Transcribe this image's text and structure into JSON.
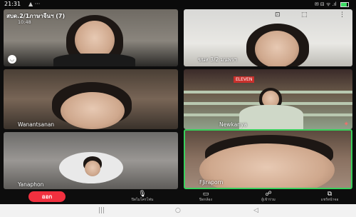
{
  "status_bar": {
    "time": "21:31",
    "extra": "▲ ···",
    "icons": "✉ ⊟ ᯤ .ıl",
    "battery_level": 0.8
  },
  "call": {
    "title": "สบด.2/1ภาษาจีนฯ (7)",
    "subtitle": "10:48"
  },
  "participants": [
    {
      "name": ""
    },
    {
      "name": "ขนส 3/2 มนพรฯ"
    },
    {
      "name": "Wanantsanan"
    },
    {
      "name": "Newkanya"
    },
    {
      "name": "Yanaphon"
    },
    {
      "name": "FJiraporn"
    }
  ],
  "store_sign": "ELEVEN",
  "controls": {
    "leave_label": "ออก",
    "items": [
      {
        "icon": "microphone-icon",
        "glyph": "🎙",
        "label": "ปิดไมโครโฟน"
      },
      {
        "icon": "video-camera-icon",
        "glyph": "▭",
        "label": "ปิดกล้อง"
      },
      {
        "icon": "participants-icon",
        "glyph": "☍",
        "label": "ผู้เข้าร่วม"
      },
      {
        "icon": "share-screen-icon",
        "glyph": "⧉",
        "label": "แชร์หน้าจอ"
      }
    ]
  },
  "nav": {
    "recent": "|||",
    "home": "○",
    "back": "◁"
  },
  "colors": {
    "leave": "#f2303f",
    "active_speaker": "#39d05c"
  }
}
